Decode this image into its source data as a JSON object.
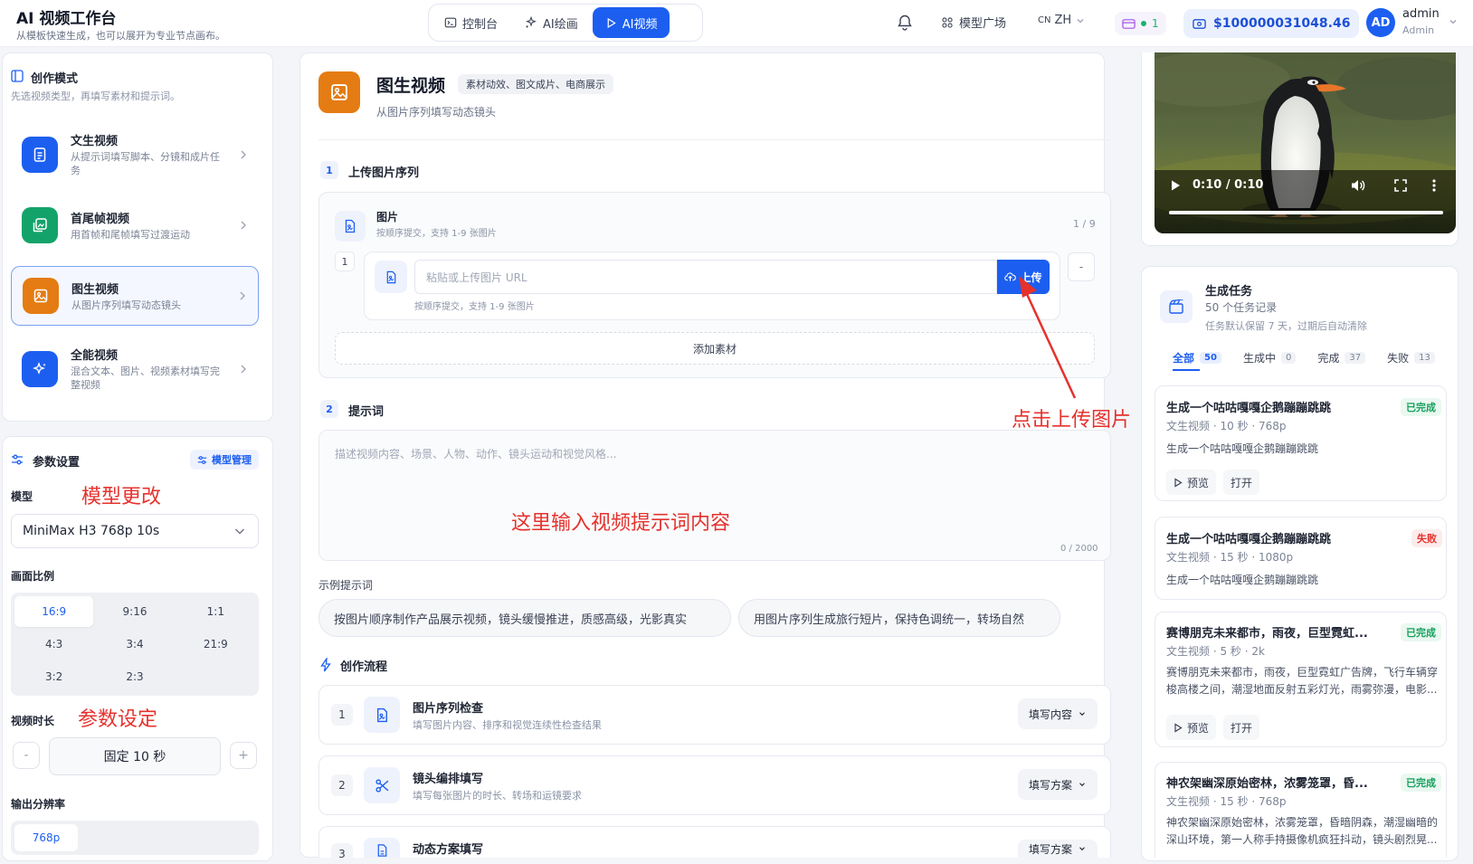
{
  "header": {
    "title": "AI 视频工作台",
    "subtitle": "从模板快速生成，也可以展开为专业节点画布。",
    "nav": [
      {
        "label": "控制台"
      },
      {
        "label": "AI绘画"
      },
      {
        "label": "AI视频"
      }
    ],
    "model_market": "模型广场",
    "lang_prefix": "CN",
    "lang": "ZH",
    "message_count": "1",
    "balance": "$100000031048.46",
    "avatar_initials": "AD",
    "user_name": "admin",
    "user_role": "Admin"
  },
  "modes": {
    "title": "创作模式",
    "desc": "先选视频类型，再填写素材和提示词。",
    "items": [
      {
        "name": "文生视频",
        "desc": "从提示词填写脚本、分镜和成片任务"
      },
      {
        "name": "首尾帧视频",
        "desc": "用首帧和尾帧填写过渡运动"
      },
      {
        "name": "图生视频",
        "desc": "从图片序列填写动态镜头"
      },
      {
        "name": "全能视频",
        "desc": "混合文本、图片、视频素材填写完整视频"
      }
    ]
  },
  "params": {
    "title": "参数设置",
    "manage_label": "模型管理",
    "model_label": "模型",
    "model_value": "MiniMax H3 768p 10s",
    "ratio_label": "画面比例",
    "ratios": [
      "16:9",
      "9:16",
      "1:1",
      "4:3",
      "3:4",
      "21:9",
      "3:2",
      "2:3"
    ],
    "duration_label": "视频时长",
    "duration_minus": "-",
    "duration_value": "固定 10 秒",
    "duration_plus": "+",
    "resolution_label": "输出分辨率",
    "resolution_value": "768p"
  },
  "annotations": {
    "model": "模型更改",
    "params": "参数设定",
    "prompt": "这里输入视频提示词内容",
    "upload": "点击上传图片"
  },
  "main": {
    "title": "图生视频",
    "tag": "素材动效、图文成片、电商展示",
    "subtitle": "从图片序列填写动态镜头",
    "step1_no": "1",
    "step1_label": "上传图片序列",
    "image_title": "图片",
    "image_desc": "按顺序提交，支持 1-9 张图片",
    "image_count": "1 / 9",
    "row_index": "1",
    "url_placeholder": "粘贴或上传图片 URL",
    "upload_label": "上传",
    "row_hint": "按顺序提交，支持 1-9 张图片",
    "remove_label": "-",
    "add_material": "添加素材",
    "step2_no": "2",
    "step2_label": "提示词",
    "prompt_placeholder": "描述视频内容、场景、人物、动作、镜头运动和视觉风格...",
    "prompt_count": "0 / 2000",
    "examples_label": "示例提示词",
    "examples": [
      "按图片顺序制作产品展示视频，镜头缓慢推进，质感高级，光影真实",
      "用图片序列生成旅行短片，保持色调统一，转场自然"
    ],
    "flow_title": "创作流程",
    "flow": [
      {
        "no": "1",
        "title": "图片序列检查",
        "desc": "填写图片内容、排序和视觉连续性检查结果",
        "btn": "填写内容"
      },
      {
        "no": "2",
        "title": "镜头编排填写",
        "desc": "填写每张图片的时长、转场和运镜要求",
        "btn": "填写方案"
      },
      {
        "no": "3",
        "title": "动态方案填写",
        "desc": "",
        "btn": "填写方案"
      }
    ]
  },
  "video": {
    "time": "0:10 / 0:10",
    "progress": 1.0
  },
  "tasks": {
    "title": "生成任务",
    "count_text": "50 个任务记录",
    "retention": "任务默认保留 7 天，过期后自动清除",
    "tabs": [
      {
        "label": "全部",
        "count": "50"
      },
      {
        "label": "生成中",
        "count": "0"
      },
      {
        "label": "完成",
        "count": "37"
      },
      {
        "label": "失败",
        "count": "13"
      }
    ],
    "preview_label": "预览",
    "open_label": "打开",
    "items": [
      {
        "title": "生成一个咕咕嘎嘎企鹅蹦蹦跳跳",
        "meta": "文生视频 · 10 秒 · 768p",
        "body": "生成一个咕咕嘎嘎企鹅蹦蹦跳跳",
        "status": "已完成"
      },
      {
        "title": "生成一个咕咕嘎嘎企鹅蹦蹦跳跳",
        "meta": "文生视频 · 15 秒 · 1080p",
        "body": "生成一个咕咕嘎嘎企鹅蹦蹦跳跳",
        "status": "失败"
      },
      {
        "title": "赛博朋克未来都市，雨夜，巨型霓虹...",
        "meta": "文生视频 · 5 秒 · 2k",
        "body": "赛博朋克未来都市，雨夜，巨型霓虹广告牌，飞行车辆穿梭高楼之间，潮湿地面反射五彩灯光，雨雾弥漫，电影...",
        "status": "已完成"
      },
      {
        "title": "神农架幽深原始密林，浓雾笼罩，昏...",
        "meta": "文生视频 · 15 秒 · 768p",
        "body": "神农架幽深原始密林，浓雾笼罩，昏暗阴森，潮湿幽暗的深山环境，第一人称手持摄像机疯狂抖动，镜头剧烈晃...",
        "status": "已完成"
      }
    ]
  },
  "colors": {
    "accent": "#1c5ff0",
    "orange": "#e47c13",
    "annotation": "#e5322d"
  }
}
